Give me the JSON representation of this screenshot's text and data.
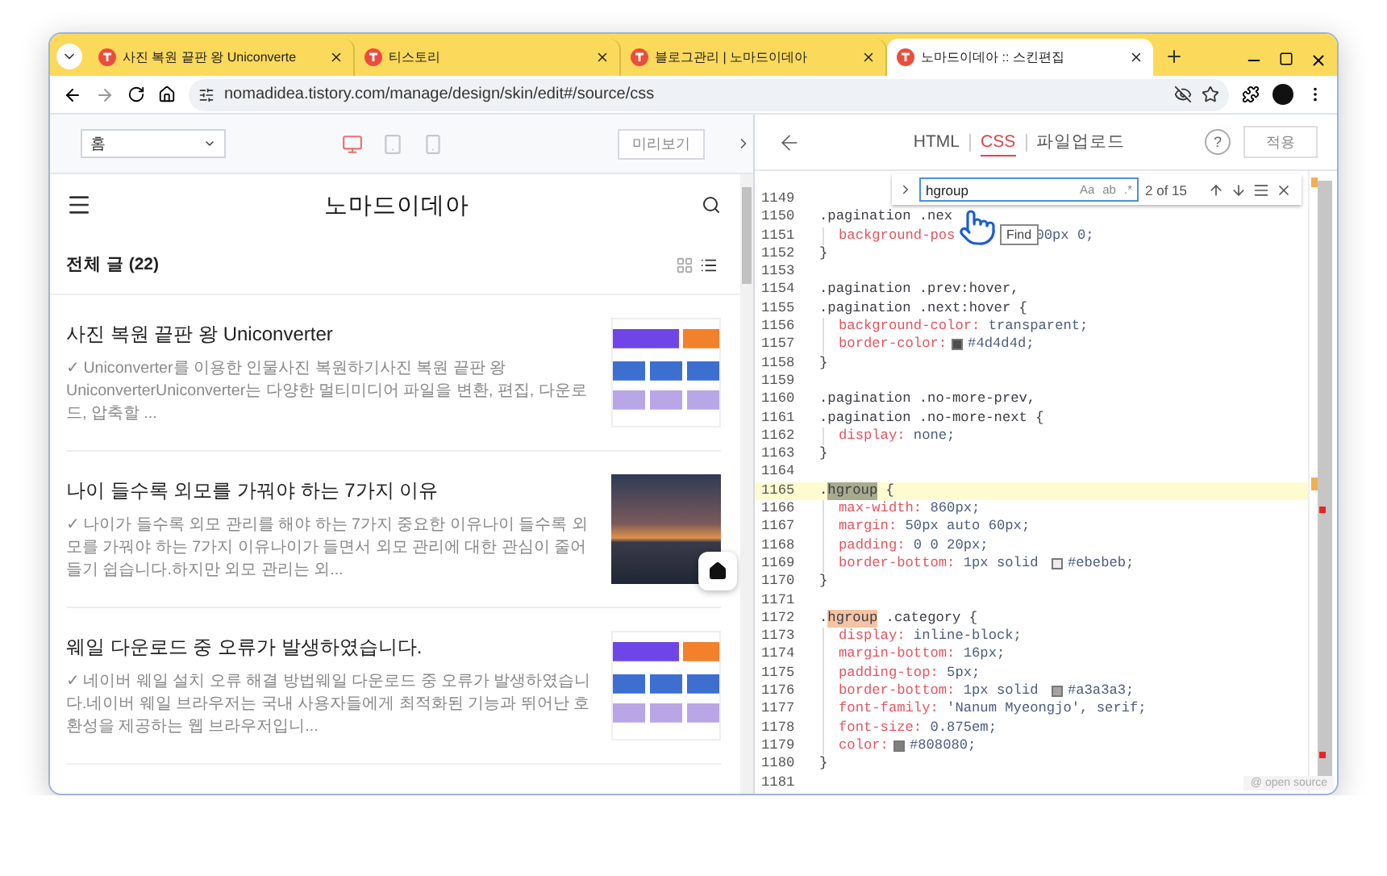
{
  "browser": {
    "tabs": [
      {
        "title": "사진 복원 끝판 왕 Uniconverte",
        "selected": false
      },
      {
        "title": "티스토리",
        "selected": false
      },
      {
        "title": "블로그관리 | 노마드이데아",
        "selected": false
      },
      {
        "title": "노마드이데아 :: 스킨편집",
        "selected": true
      }
    ],
    "address": "nomadidea.tistory.com/manage/design/skin/edit#/source/css"
  },
  "preview_toolbar": {
    "page_select": "홈",
    "devices": [
      {
        "kind": "desktop",
        "selected": true
      },
      {
        "kind": "tablet",
        "selected": false
      },
      {
        "kind": "mobile",
        "selected": false
      }
    ],
    "preview_button": "미리보기"
  },
  "blog": {
    "title": "노마드이데아",
    "section": "전체 글 (22)",
    "view_modes": [
      {
        "kind": "grid",
        "selected": false
      },
      {
        "kind": "list",
        "selected": true
      }
    ],
    "posts": [
      {
        "kind": "screenshot",
        "title": "사진 복원 끝판 왕 Uniconverter",
        "excerpt": "✓ Uniconverter를 이용한 인물사진 복원하기사진 복원 끝판 왕 UniconverterUniconverter는 다양한 멀티미디어 파일을 변환, 편집, 다운로드, 압축할 ..."
      },
      {
        "kind": "photo",
        "title": "나이 들수록 외모를 가꿔야 하는 7가지 이유",
        "excerpt": "✓ 나이가 들수록 외모 관리를 해야 하는 7가지 중요한 이유나이 들수록 외모를 가꿔야 하는 7가지 이유나이가 들면서 외모 관리에 대한 관심이 줄어들기 쉽습니다.하지만 외모 관리는 외..."
      },
      {
        "kind": "screenshot",
        "title": "웨일 다운로드 중 오류가 발생하였습니다.",
        "excerpt": "✓ 네이버 웨일 설치 오류 해결 방법웨일 다운로드 중 오류가 발생하였습니다.네이버 웨일 브라우저는 국내 사용자들에게 최적화된 기능과 뛰어난 호환성을 제공하는 웹 브라우저입니..."
      }
    ]
  },
  "editor": {
    "tabs": [
      {
        "label": "HTML",
        "selected": false
      },
      {
        "label": "CSS",
        "selected": true
      },
      {
        "label": "파일업로드",
        "selected": false
      }
    ],
    "help": "?",
    "apply_button": "적용",
    "find": {
      "query": "hgroup",
      "options": [
        "Aa",
        "ab",
        ".*"
      ],
      "count": "2 of 15",
      "tooltip": "Find"
    },
    "footer": "@ open source",
    "lines": [
      {
        "number": "1149",
        "current": false,
        "indented": false
      },
      {
        "number": "1150",
        "current": false,
        "indented": false,
        "tokens": [
          {
            "kind": "sel",
            "text": ".pagination .nex"
          }
        ]
      },
      {
        "number": "1151",
        "current": false,
        "indented": true,
        "tokens": [
          {
            "kind": "prop",
            "text": "background-pos"
          },
          {
            "kind": "hidden"
          },
          {
            "kind": "val",
            "text": "00px 0;"
          }
        ]
      },
      {
        "number": "1152",
        "current": false,
        "indented": false,
        "tokens": [
          {
            "kind": "sel",
            "text": "}"
          }
        ]
      },
      {
        "number": "1153",
        "current": false,
        "indented": false
      },
      {
        "number": "1154",
        "current": false,
        "indented": false,
        "tokens": [
          {
            "kind": "sel",
            "text": ".pagination .prev:hover,"
          }
        ]
      },
      {
        "number": "1155",
        "current": false,
        "indented": false,
        "tokens": [
          {
            "kind": "sel",
            "text": ".pagination .next:hover {"
          }
        ]
      },
      {
        "number": "1156",
        "current": false,
        "indented": true,
        "tokens": [
          {
            "kind": "prop",
            "text": "background-color:"
          },
          {
            "kind": "val",
            "text": " transparent;"
          }
        ]
      },
      {
        "number": "1157",
        "current": false,
        "indented": true,
        "tokens": [
          {
            "kind": "prop",
            "text": "border-color:"
          },
          {
            "kind": "swatch",
            "color": "#4d4d4d"
          },
          {
            "kind": "val",
            "text": "#4d4d4d;"
          }
        ]
      },
      {
        "number": "1158",
        "current": false,
        "indented": false,
        "tokens": [
          {
            "kind": "sel",
            "text": "}"
          }
        ]
      },
      {
        "number": "1159",
        "current": false,
        "indented": false
      },
      {
        "number": "1160",
        "current": false,
        "indented": false,
        "tokens": [
          {
            "kind": "sel",
            "text": ".pagination .no-more-prev,"
          }
        ]
      },
      {
        "number": "1161",
        "current": false,
        "indented": false,
        "tokens": [
          {
            "kind": "sel",
            "text": ".pagination .no-more-next {"
          }
        ]
      },
      {
        "number": "1162",
        "current": false,
        "indented": true,
        "tokens": [
          {
            "kind": "prop",
            "text": "display:"
          },
          {
            "kind": "val",
            "text": " none;"
          }
        ]
      },
      {
        "number": "1163",
        "current": false,
        "indented": false,
        "tokens": [
          {
            "kind": "sel",
            "text": "}"
          }
        ]
      },
      {
        "number": "1164",
        "current": false,
        "indented": false
      },
      {
        "number": "1165",
        "current": true,
        "indented": false,
        "tokens": [
          {
            "kind": "sel",
            "text": "."
          },
          {
            "kind": "current-match",
            "text": "hgroup"
          },
          {
            "kind": "sel",
            "text": " {"
          }
        ]
      },
      {
        "number": "1166",
        "current": false,
        "indented": true,
        "tokens": [
          {
            "kind": "prop",
            "text": "max-width:"
          },
          {
            "kind": "val",
            "text": " 860px;"
          }
        ]
      },
      {
        "number": "1167",
        "current": false,
        "indented": true,
        "tokens": [
          {
            "kind": "prop",
            "text": "margin:"
          },
          {
            "kind": "val",
            "text": " 50px auto 60px;"
          }
        ]
      },
      {
        "number": "1168",
        "current": false,
        "indented": true,
        "tokens": [
          {
            "kind": "prop",
            "text": "padding:"
          },
          {
            "kind": "val",
            "text": " 0 0 20px;"
          }
        ]
      },
      {
        "number": "1169",
        "current": false,
        "indented": true,
        "tokens": [
          {
            "kind": "prop",
            "text": "border-bottom:"
          },
          {
            "kind": "val",
            "text": " 1px solid "
          },
          {
            "kind": "swatch",
            "color": "#ebebeb"
          },
          {
            "kind": "val",
            "text": "#ebebeb;"
          }
        ]
      },
      {
        "number": "1170",
        "current": false,
        "indented": false,
        "tokens": [
          {
            "kind": "sel",
            "text": "}"
          }
        ]
      },
      {
        "number": "1171",
        "current": false,
        "indented": false
      },
      {
        "number": "1172",
        "current": false,
        "indented": false,
        "tokens": [
          {
            "kind": "sel",
            "text": "."
          },
          {
            "kind": "match",
            "text": "hgroup"
          },
          {
            "kind": "sel",
            "text": " .category {"
          }
        ]
      },
      {
        "number": "1173",
        "current": false,
        "indented": true,
        "tokens": [
          {
            "kind": "prop",
            "text": "display:"
          },
          {
            "kind": "val",
            "text": " inline-block;"
          }
        ]
      },
      {
        "number": "1174",
        "current": false,
        "indented": true,
        "tokens": [
          {
            "kind": "prop",
            "text": "margin-bottom:"
          },
          {
            "kind": "val",
            "text": " 16px;"
          }
        ]
      },
      {
        "number": "1175",
        "current": false,
        "indented": true,
        "tokens": [
          {
            "kind": "prop",
            "text": "padding-top:"
          },
          {
            "kind": "val",
            "text": " 5px;"
          }
        ]
      },
      {
        "number": "1176",
        "current": false,
        "indented": true,
        "tokens": [
          {
            "kind": "prop",
            "text": "border-bottom:"
          },
          {
            "kind": "val",
            "text": " 1px solid "
          },
          {
            "kind": "swatch",
            "color": "#a3a3a3"
          },
          {
            "kind": "val",
            "text": "#a3a3a3;"
          }
        ]
      },
      {
        "number": "1177",
        "current": false,
        "indented": true,
        "tokens": [
          {
            "kind": "prop",
            "text": "font-family:"
          },
          {
            "kind": "val",
            "text": " 'Nanum Myeongjo', serif;"
          }
        ]
      },
      {
        "number": "1178",
        "current": false,
        "indented": true,
        "tokens": [
          {
            "kind": "prop",
            "text": "font-size:"
          },
          {
            "kind": "val",
            "text": " 0.875em;"
          }
        ]
      },
      {
        "number": "1179",
        "current": false,
        "indented": true,
        "tokens": [
          {
            "kind": "prop",
            "text": "color:"
          },
          {
            "kind": "swatch",
            "color": "#808080"
          },
          {
            "kind": "val",
            "text": "#808080;"
          }
        ]
      },
      {
        "number": "1180",
        "current": false,
        "indented": false,
        "tokens": [
          {
            "kind": "sel",
            "text": "}"
          }
        ]
      },
      {
        "number": "1181",
        "current": false,
        "indented": false
      }
    ]
  }
}
